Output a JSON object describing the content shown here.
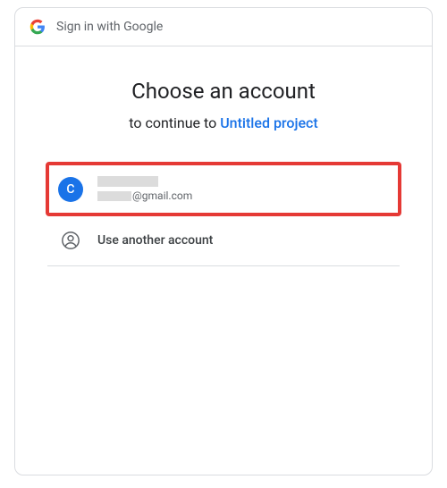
{
  "header": {
    "label": "Sign in with Google"
  },
  "title": "Choose an account",
  "subtitle_prefix": "to continue to ",
  "subtitle_link": "Untitled project",
  "accounts": [
    {
      "avatar_letter": "C",
      "email_suffix": "@gmail.com"
    }
  ],
  "use_another_label": "Use another account"
}
